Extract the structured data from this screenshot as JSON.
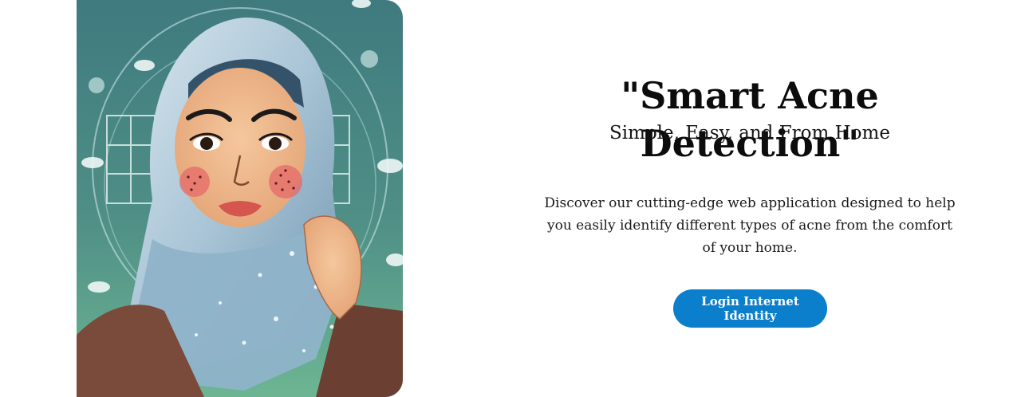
{
  "hero": {
    "title": "\"Smart Acne Detection\"",
    "subtitle": "Simple, Easy, and From Home",
    "description": "Discover our cutting-edge web application designed to help you easily identify different types of acne from the comfort of your home.",
    "login_label": "Login Internet Identity"
  },
  "colors": {
    "accent": "#0b7fcc",
    "background": "#ffffff",
    "title_text": "#0c0c0c"
  },
  "illustration": {
    "subject": "woman-in-hijab-with-acne-illustration"
  }
}
